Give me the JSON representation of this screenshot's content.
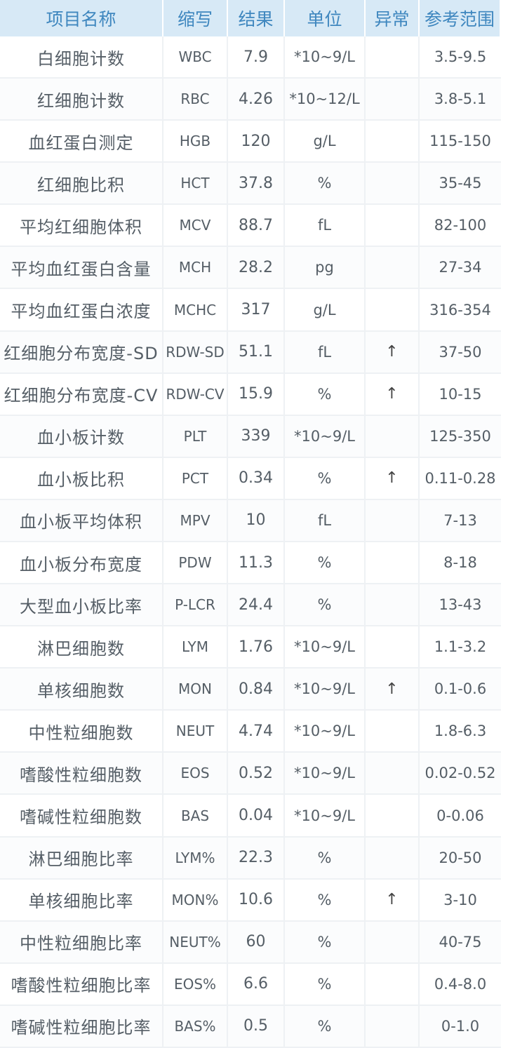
{
  "headers": [
    "项目名称",
    "缩写",
    "结果",
    "单位",
    "异常",
    "参考范围"
  ],
  "rows": [
    {
      "name": "白细胞计数",
      "abbr": "WBC",
      "result": "7.9",
      "unit": "*10~9/L",
      "abnormal": "",
      "ref": "3.5-9.5"
    },
    {
      "name": "红细胞计数",
      "abbr": "RBC",
      "result": "4.26",
      "unit": "*10~12/L",
      "abnormal": "",
      "ref": "3.8-5.1"
    },
    {
      "name": "血红蛋白测定",
      "abbr": "HGB",
      "result": "120",
      "unit": "g/L",
      "abnormal": "",
      "ref": "115-150"
    },
    {
      "name": "红细胞比积",
      "abbr": "HCT",
      "result": "37.8",
      "unit": "%",
      "abnormal": "",
      "ref": "35-45"
    },
    {
      "name": "平均红细胞体积",
      "abbr": "MCV",
      "result": "88.7",
      "unit": "fL",
      "abnormal": "",
      "ref": "82-100"
    },
    {
      "name": "平均血红蛋白含量",
      "abbr": "MCH",
      "result": "28.2",
      "unit": "pg",
      "abnormal": "",
      "ref": "27-34"
    },
    {
      "name": "平均血红蛋白浓度",
      "abbr": "MCHC",
      "result": "317",
      "unit": "g/L",
      "abnormal": "",
      "ref": "316-354"
    },
    {
      "name": "红细胞分布宽度-SD",
      "abbr": "RDW-SD",
      "result": "51.1",
      "unit": "fL",
      "abnormal": "↑",
      "ref": "37-50"
    },
    {
      "name": "红细胞分布宽度-CV",
      "abbr": "RDW-CV",
      "result": "15.9",
      "unit": "%",
      "abnormal": "↑",
      "ref": "10-15"
    },
    {
      "name": "血小板计数",
      "abbr": "PLT",
      "result": "339",
      "unit": "*10~9/L",
      "abnormal": "",
      "ref": "125-350"
    },
    {
      "name": "血小板比积",
      "abbr": "PCT",
      "result": "0.34",
      "unit": "%",
      "abnormal": "↑",
      "ref": "0.11-0.28"
    },
    {
      "name": "血小板平均体积",
      "abbr": "MPV",
      "result": "10",
      "unit": "fL",
      "abnormal": "",
      "ref": "7-13"
    },
    {
      "name": "血小板分布宽度",
      "abbr": "PDW",
      "result": "11.3",
      "unit": "%",
      "abnormal": "",
      "ref": "8-18"
    },
    {
      "name": "大型血小板比率",
      "abbr": "P-LCR",
      "result": "24.4",
      "unit": "%",
      "abnormal": "",
      "ref": "13-43"
    },
    {
      "name": "淋巴细胞数",
      "abbr": "LYM",
      "result": "1.76",
      "unit": "*10~9/L",
      "abnormal": "",
      "ref": "1.1-3.2"
    },
    {
      "name": "单核细胞数",
      "abbr": "MON",
      "result": "0.84",
      "unit": "*10~9/L",
      "abnormal": "↑",
      "ref": "0.1-0.6"
    },
    {
      "name": "中性粒细胞数",
      "abbr": "NEUT",
      "result": "4.74",
      "unit": "*10~9/L",
      "abnormal": "",
      "ref": "1.8-6.3"
    },
    {
      "name": "嗜酸性粒细胞数",
      "abbr": "EOS",
      "result": "0.52",
      "unit": "*10~9/L",
      "abnormal": "",
      "ref": "0.02-0.52"
    },
    {
      "name": "嗜碱性粒细胞数",
      "abbr": "BAS",
      "result": "0.04",
      "unit": "*10~9/L",
      "abnormal": "",
      "ref": "0-0.06"
    },
    {
      "name": "淋巴细胞比率",
      "abbr": "LYM%",
      "result": "22.3",
      "unit": "%",
      "abnormal": "",
      "ref": "20-50"
    },
    {
      "name": "单核细胞比率",
      "abbr": "MON%",
      "result": "10.6",
      "unit": "%",
      "abnormal": "↑",
      "ref": "3-10"
    },
    {
      "name": "中性粒细胞比率",
      "abbr": "NEUT%",
      "result": "60",
      "unit": "%",
      "abnormal": "",
      "ref": "40-75"
    },
    {
      "name": "嗜酸性粒细胞比率",
      "abbr": "EOS%",
      "result": "6.6",
      "unit": "%",
      "abnormal": "",
      "ref": "0.4-8.0"
    },
    {
      "name": "嗜碱性粒细胞比率",
      "abbr": "BAS%",
      "result": "0.5",
      "unit": "%",
      "abnormal": "",
      "ref": "0-1.0"
    }
  ]
}
